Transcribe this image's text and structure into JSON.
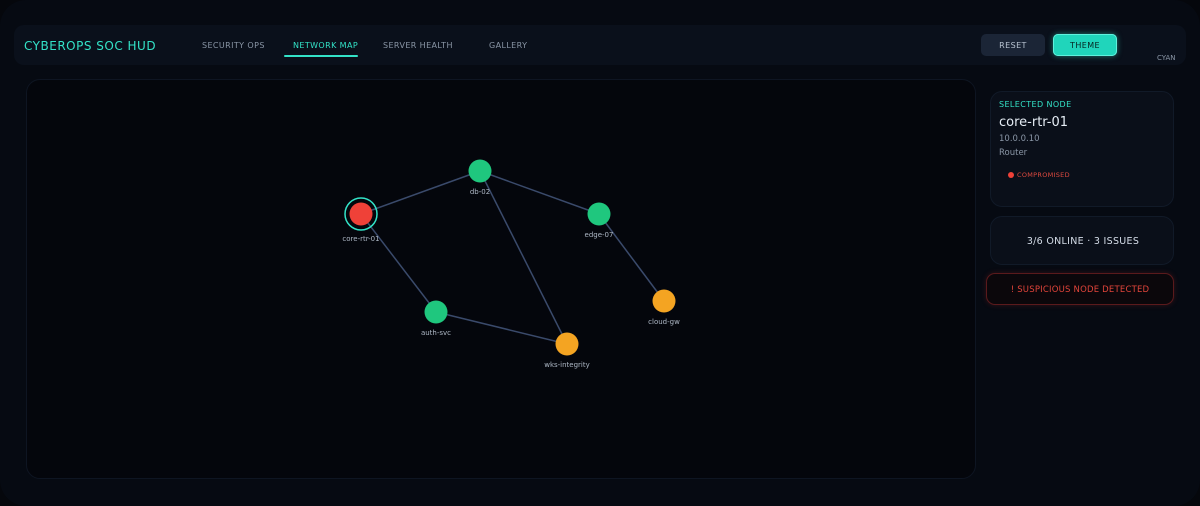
{
  "header": {
    "title": "CYBEROPS SOC HUD",
    "tabs": [
      {
        "label": "SECURITY OPS",
        "active": false
      },
      {
        "label": "NETWORK MAP",
        "active": true
      },
      {
        "label": "SERVER HEALTH",
        "active": false
      },
      {
        "label": "GALLERY",
        "active": false
      }
    ],
    "reset_label": "RESET",
    "theme_label": "THEME",
    "theme_name": "CYAN"
  },
  "network": {
    "nodes": [
      {
        "id": "core-rtr-01",
        "label": "core-rtr-01",
        "status": "compromised",
        "color": "#ef4138",
        "selected": true
      },
      {
        "id": "db-02",
        "label": "db-02",
        "status": "online",
        "color": "#1fc77e"
      },
      {
        "id": "edge-07",
        "label": "edge-07",
        "status": "online",
        "color": "#1fc77e"
      },
      {
        "id": "auth-svc",
        "label": "auth-svc",
        "status": "online",
        "color": "#1fc77e"
      },
      {
        "id": "wks-integrity",
        "label": "wks-integrity",
        "status": "warning",
        "color": "#f4a422"
      },
      {
        "id": "cloud-gw",
        "label": "cloud-gw",
        "status": "warning",
        "color": "#f4a422"
      }
    ],
    "links": [
      [
        "core-rtr-01",
        "db-02"
      ],
      [
        "db-02",
        "edge-07"
      ],
      [
        "db-02",
        "wks-integrity"
      ],
      [
        "edge-07",
        "cloud-gw"
      ],
      [
        "core-rtr-01",
        "auth-svc"
      ],
      [
        "auth-svc",
        "wks-integrity"
      ]
    ],
    "link_color": "#3a4a6b",
    "selection_ring_color": "#33e3c8"
  },
  "selected_node": {
    "heading": "SELECTED NODE",
    "name": "core-rtr-01",
    "ip": "10.0.0.10",
    "type": "Router",
    "status": "COMPROMISED",
    "status_color": "#ef4138"
  },
  "summary": {
    "text": "3/6 ONLINE  ·  3 ISSUES"
  },
  "alert": {
    "text": "! SUSPICIOUS NODE DETECTED",
    "color": "#e0443a"
  },
  "colors": {
    "accent": "#33e3c8",
    "background": "#060a12"
  }
}
